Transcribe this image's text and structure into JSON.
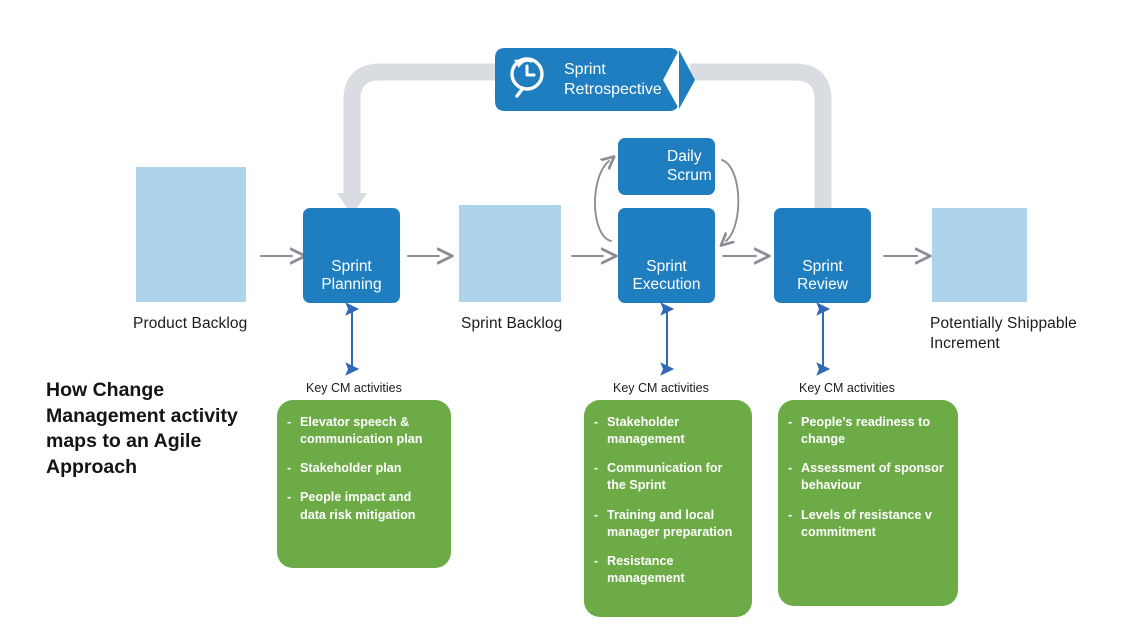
{
  "headline": "How Change Management activity maps to an Agile Approach",
  "colors": {
    "process_blue": "#1f7ec0",
    "artifact_light_blue": "#aed4ec",
    "activity_green": "#6cab46",
    "ribbon_gray": "#d9dde1",
    "arrow_gray": "#8a8f95",
    "arrow_blue": "#3069b5",
    "text_dark": "#1c1c1c"
  },
  "artifacts": [
    {
      "id": "product-backlog",
      "caption": "Product Backlog",
      "icon": "list-document-icon",
      "rows": 6
    },
    {
      "id": "sprint-backlog",
      "caption": "Sprint Backlog",
      "icon": "list-document-icon",
      "rows": 3
    },
    {
      "id": "potentially-shippable-increment",
      "caption": "Potentially Shippable\nIncrement",
      "icon": "delivery-truck-icon",
      "rows": 0
    }
  ],
  "process_steps": [
    {
      "id": "sprint-planning",
      "label": "Sprint\nPlanning",
      "icon": "cycle-arrow-icon"
    },
    {
      "id": "sprint-execution",
      "label": "Sprint\nExecution",
      "icon": "backlog-to-board-icon"
    },
    {
      "id": "sprint-review",
      "label": "Sprint\nReview",
      "icon": "magnifier-board-icon"
    }
  ],
  "daily_scrum": {
    "id": "daily-scrum",
    "label": "Daily\nScrum",
    "icon": "person-cycle-icon"
  },
  "retrospective": {
    "id": "sprint-retrospective",
    "label": "Sprint\nRetrospective",
    "icon": "clock-back-magnifier-icon"
  },
  "cm_groups": [
    {
      "id": "cm-sprint-planning",
      "title": "Key CM activities",
      "bullet": "-",
      "items": [
        "Elevator speech & communication plan",
        "Stakeholder plan",
        "People impact and data risk mitigation"
      ]
    },
    {
      "id": "cm-sprint-execution",
      "title": "Key CM activities",
      "bullet": "-",
      "items": [
        "Stakeholder management",
        "Communication for the Sprint",
        "Training and local manager preparation",
        "Resistance management"
      ]
    },
    {
      "id": "cm-sprint-review",
      "title": "Key CM activities",
      "bullet": "-",
      "items": [
        "People’s readiness to change",
        "Assessment of sponsor behaviour",
        "Levels of resistance v commitment"
      ]
    }
  ]
}
